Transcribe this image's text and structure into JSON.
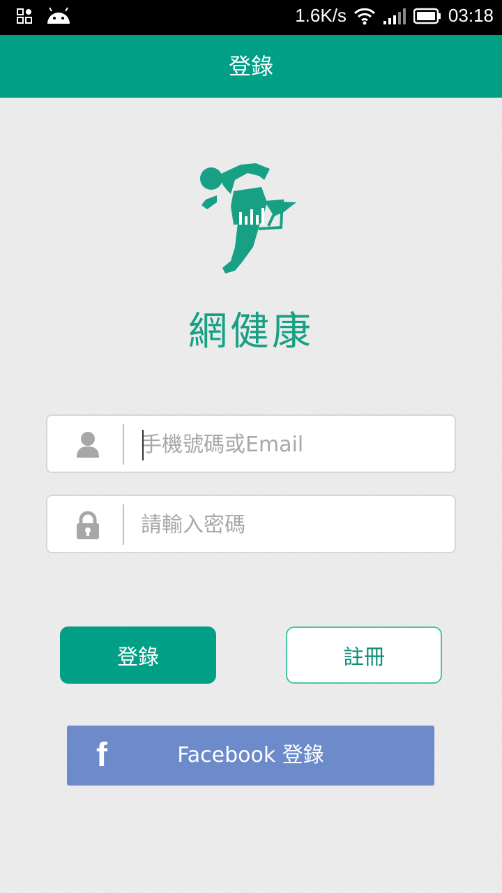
{
  "status_bar": {
    "net_speed": "1.6K/s",
    "time": "03:18",
    "icons": [
      "qr-apps-icon",
      "android-icon",
      "wifi-icon",
      "signal-icon",
      "battery-icon"
    ]
  },
  "app_bar": {
    "title": "登錄"
  },
  "brand": {
    "name": "網健康",
    "color": "#17a084"
  },
  "form": {
    "account": {
      "placeholder": "手機號碼或Email",
      "value": ""
    },
    "password": {
      "placeholder": "請輸入密碼",
      "value": ""
    }
  },
  "buttons": {
    "login": "登錄",
    "register": "註冊",
    "facebook": "Facebook 登錄"
  },
  "colors": {
    "primary": "#009f86",
    "facebook": "#6d8bcb"
  }
}
